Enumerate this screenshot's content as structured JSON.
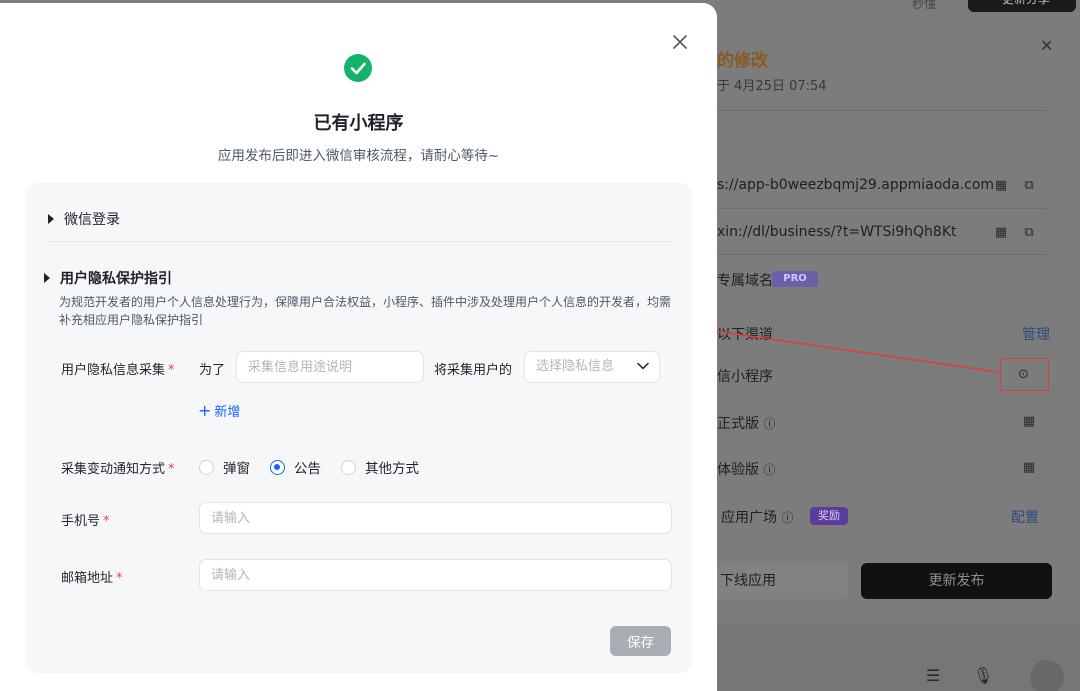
{
  "background": {
    "top_label": "秒懂",
    "share_button": "更新分享",
    "drawer_title": "的修改",
    "drawer_time": "于 4月25日 07:54",
    "url_1": "s://app-b0weezbqmj29.appmiaoda.com",
    "url_2": "xin://dl/business/?t=WTSi9hQh8Kt",
    "custom_domain_label": "专属域名",
    "pro_badge": "PRO",
    "channels_label": "以下渠道",
    "manage_link": "管理",
    "mini_program_label": "信小程序",
    "release_label": "正式版",
    "trial_label": "体验版",
    "app_plaza_label": "应用广场",
    "reward_badge": "奖励",
    "config_link": "配置",
    "offline_button": "下线应用",
    "publish_button": "更新发布"
  },
  "modal": {
    "title": "已有小程序",
    "subtitle": "应用发布后即进入微信审核流程，请耐心等待~",
    "wechat_login_section": "微信登录",
    "privacy_section": "用户隐私保护指引",
    "privacy_description": "为规范开发者的用户个人信息处理行为，保障用户合法权益，小程序、插件中涉及处理用户个人信息的开发者，均需补充相应用户隐私保护指引",
    "privacy_collect_label": "用户隐私信息采集",
    "for_text": "为了",
    "purpose_placeholder": "采集信息用途说明",
    "will_collect_text": "将采集用户的",
    "privacy_select_placeholder": "选择隐私信息",
    "add_link": "新增",
    "notify_method_label": "采集变动通知方式",
    "notify_options": [
      "弹窗",
      "公告",
      "其他方式"
    ],
    "notify_selected": "公告",
    "phone_label": "手机号",
    "phone_placeholder": "请输入",
    "email_label": "邮箱地址",
    "email_placeholder": "请输入",
    "required_mark": "*",
    "save_button": "保存"
  },
  "colors": {
    "success": "#17b26a",
    "primary": "#1664ff",
    "required": "#f53f3f",
    "annotation": "#e03c3c"
  }
}
